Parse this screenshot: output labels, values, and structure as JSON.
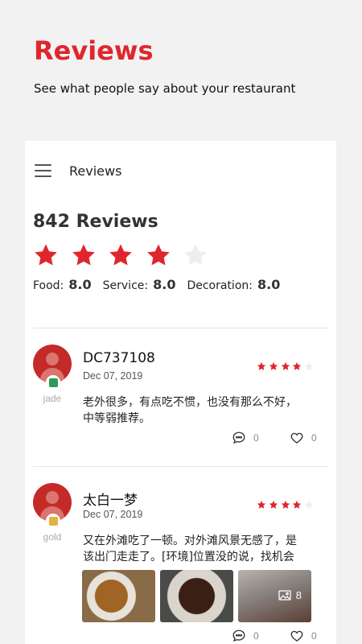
{
  "hero": {
    "title": "Reviews",
    "subtitle": "See what people say about your restaurant"
  },
  "topbar": {
    "title": "Reviews"
  },
  "summary": {
    "count_text": "842 Reviews",
    "rating": 4,
    "scores": [
      {
        "label": "Food:",
        "value": "8.0"
      },
      {
        "label": "Service:",
        "value": "8.0"
      },
      {
        "label": "Decoration:",
        "value": "8.0"
      }
    ]
  },
  "colors": {
    "accent": "#e0262d",
    "star_filled": "#e0262d",
    "star_empty": "#eeeeee"
  },
  "reviews": [
    {
      "username": "DC737108",
      "level": "jade",
      "level_color": "#2e9a5a",
      "date": "Dec 07, 2019",
      "rating": 4,
      "text": "老外很多，有点吃不惯，也没有那么不好，\n中等弱推荐。",
      "comment_count": "0",
      "like_count": "0"
    },
    {
      "username": "太白一梦",
      "level": "gold",
      "level_color": "#e2b43c",
      "date": "Dec 07, 2019",
      "rating": 4,
      "text": "又在外滩吃了一顿。对外滩风景无感了，是\n该出门走走了。[环境]位置没的说，找机会",
      "photo_count": "8",
      "comment_count": "0",
      "like_count": "0"
    }
  ]
}
